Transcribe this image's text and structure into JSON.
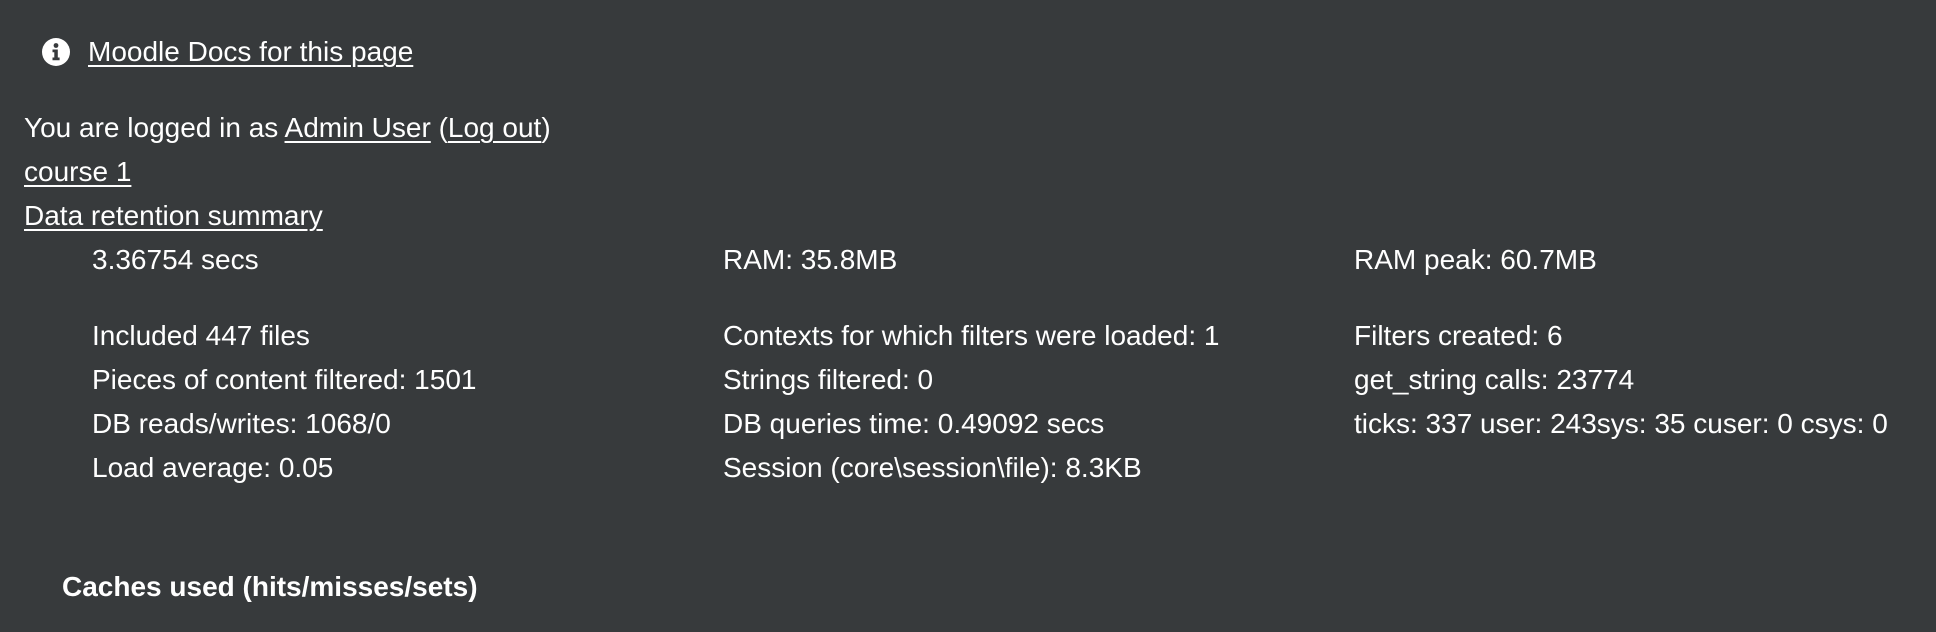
{
  "docs_link": {
    "label": "Moodle Docs for this page",
    "icon": "info-circle-icon"
  },
  "login": {
    "prefix": "You are logged in as ",
    "user_name": "Admin User",
    "open_paren": " (",
    "logout_label": "Log out",
    "close_paren": ")"
  },
  "course_link": "course 1",
  "data_retention_link": "Data retention summary",
  "performance": {
    "time": "3.36754 secs",
    "ram": "RAM: 35.8MB",
    "ram_peak": "RAM peak: 60.7MB",
    "included_files": "Included 447 files",
    "contexts_filters": "Contexts for which filters were loaded: 1",
    "filters_created": "Filters created: 6",
    "pieces_filtered": "Pieces of content filtered: 1501",
    "strings_filtered": "Strings filtered: 0",
    "get_string_calls": "get_string calls: 23774",
    "db_reads_writes": "DB reads/writes: 1068/0",
    "db_queries_time": "DB queries time: 0.49092 secs",
    "ticks": "ticks: 337 user: 243sys: 35 cuser: 0 csys: 0",
    "load_average": "Load average: 0.05",
    "session": "Session (core\\session\\file): 8.3KB"
  },
  "caches_heading": "Caches used (hits/misses/sets)"
}
